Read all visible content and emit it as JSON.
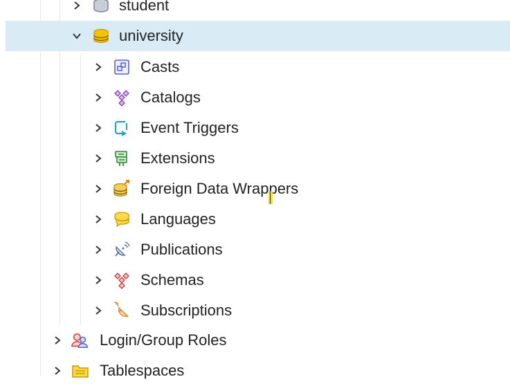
{
  "tree": {
    "student": {
      "label": "student"
    },
    "university": {
      "label": "university"
    },
    "children": [
      {
        "label": "Casts",
        "icon": "casts-icon"
      },
      {
        "label": "Catalogs",
        "icon": "catalogs-icon"
      },
      {
        "label": "Event Triggers",
        "icon": "event-triggers-icon"
      },
      {
        "label": "Extensions",
        "icon": "extensions-icon"
      },
      {
        "label": "Foreign Data Wrappers",
        "icon": "foreign-data-wrappers-icon"
      },
      {
        "label": "Languages",
        "icon": "languages-icon"
      },
      {
        "label": "Publications",
        "icon": "publications-icon"
      },
      {
        "label": "Schemas",
        "icon": "schemas-icon"
      },
      {
        "label": "Subscriptions",
        "icon": "subscriptions-icon"
      }
    ],
    "login_group_roles": {
      "label": "Login/Group Roles"
    },
    "tablespaces": {
      "label": "Tablespaces"
    }
  },
  "colors": {
    "selected_row": "#d9ecf6",
    "database_icon": "#e0a800",
    "cursor_highlight": "#ffe600"
  }
}
